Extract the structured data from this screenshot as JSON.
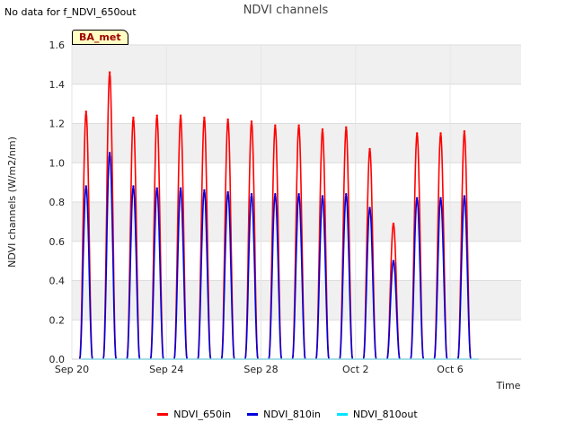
{
  "header": {
    "no_data_text": "No data for f_NDVI_650out",
    "badge_label": "BA_met"
  },
  "chart_data": {
    "type": "line",
    "title": "NDVI channels",
    "xlabel": "Time",
    "ylabel": "NDVI channels (W/m2/nm)",
    "xlim": [
      "2023-09-20",
      "2023-10-09"
    ],
    "ylim": [
      0,
      1.6
    ],
    "yticks": [
      0.0,
      0.2,
      0.4,
      0.6,
      0.8,
      1.0,
      1.2,
      1.4,
      1.6
    ],
    "xtick_labels": [
      "Sep 20",
      "Sep 24",
      "Sep 28",
      "Oct 2",
      "Oct 6"
    ],
    "xtick_values": [
      0,
      4,
      8,
      12,
      16
    ],
    "grid": true,
    "legend_position": "bottom",
    "day_offsets": [
      0.6,
      1.6,
      2.6,
      3.6,
      4.6,
      5.6,
      6.6,
      7.6,
      8.6,
      9.6,
      10.6,
      11.6,
      12.6,
      13.6,
      14.6,
      15.6,
      16.6
    ],
    "series": [
      {
        "name": "NDVI_650in",
        "color": "#ff0000",
        "daily_peak": [
          1.26,
          1.46,
          1.23,
          1.24,
          1.24,
          1.23,
          1.22,
          1.21,
          1.19,
          1.19,
          1.17,
          1.18,
          1.07,
          0.69,
          1.15,
          1.15,
          1.16
        ]
      },
      {
        "name": "NDVI_810in",
        "color": "#0000dd",
        "daily_peak": [
          0.88,
          1.05,
          0.88,
          0.87,
          0.87,
          0.86,
          0.85,
          0.84,
          0.84,
          0.84,
          0.83,
          0.84,
          0.77,
          0.5,
          0.82,
          0.82,
          0.83
        ]
      },
      {
        "name": "NDVI_810out",
        "color": "#00e5ff",
        "daily_peak": [
          0,
          0,
          0,
          0,
          0,
          0,
          0,
          0,
          0,
          0,
          0,
          0,
          0,
          0,
          0,
          0,
          0
        ]
      }
    ]
  }
}
